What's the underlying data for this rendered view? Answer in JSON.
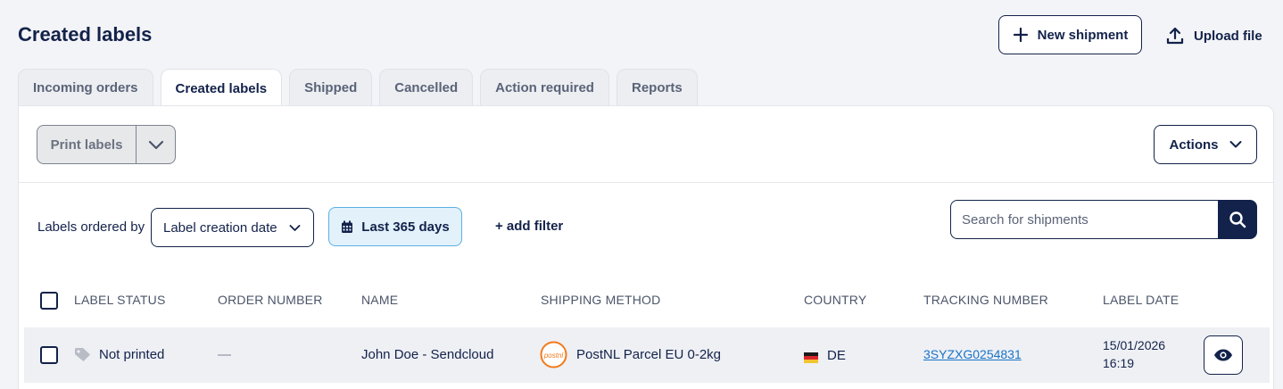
{
  "header": {
    "title": "Created labels",
    "new_shipment_label": "New shipment",
    "upload_file_label": "Upload file"
  },
  "tabs": [
    {
      "label": "Incoming orders",
      "active": false
    },
    {
      "label": "Created labels",
      "active": true
    },
    {
      "label": "Shipped",
      "active": false
    },
    {
      "label": "Cancelled",
      "active": false
    },
    {
      "label": "Action required",
      "active": false
    },
    {
      "label": "Reports",
      "active": false
    }
  ],
  "toolbar": {
    "print_labels_label": "Print labels",
    "actions_label": "Actions"
  },
  "filters": {
    "ordered_by_label": "Labels ordered by",
    "ordered_by_value": "Label creation date",
    "date_range_label": "Last 365 days",
    "add_filter_label": "+ add filter",
    "search_placeholder": "Search for shipments"
  },
  "table": {
    "columns": [
      "LABEL STATUS",
      "ORDER NUMBER",
      "NAME",
      "SHIPPING METHOD",
      "COUNTRY",
      "TRACKING NUMBER",
      "LABEL DATE"
    ],
    "rows": [
      {
        "label_status": "Not printed",
        "order_number": "—",
        "name": "John Doe - Sendcloud",
        "carrier_logo": "postnl",
        "shipping_method": "PostNL Parcel EU 0-2kg",
        "country": "DE",
        "tracking_number": "3SYZXG0254831",
        "label_date_day": "15/01/2026",
        "label_date_time": "16:19"
      }
    ]
  },
  "colors": {
    "primary": "#13224a",
    "chip_bg": "#e3f1fb",
    "chip_border": "#5ab0e2",
    "link": "#1a73c8",
    "postnl_orange": "#f27a1a"
  }
}
